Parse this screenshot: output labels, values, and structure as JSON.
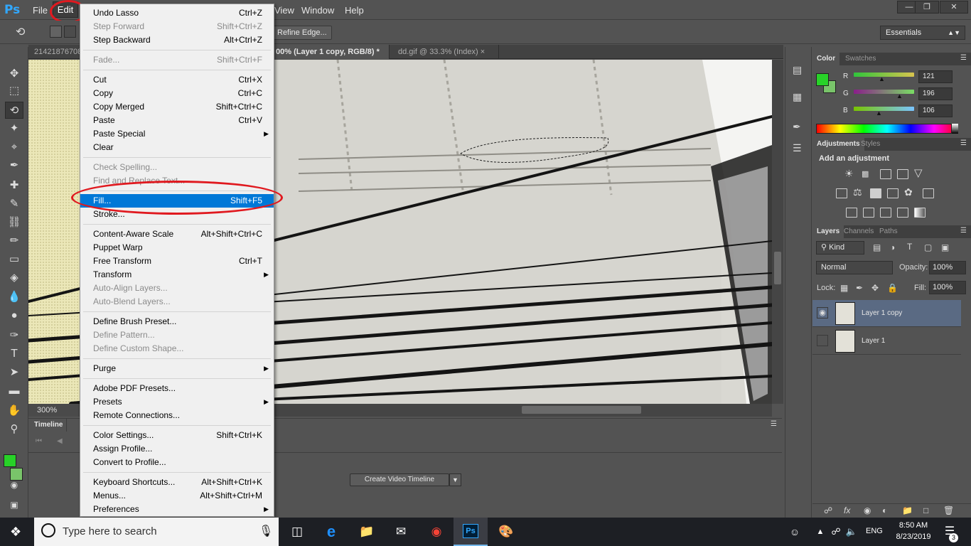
{
  "app": {
    "logo": "Ps",
    "menus": [
      "File",
      "Edit",
      "View",
      "Window",
      "Help"
    ],
    "workspace": "Essentials",
    "window_buttons": [
      "minimize-icon",
      "restore-icon",
      "close-icon"
    ]
  },
  "options_bar": {
    "refine_edge": "Refine Edge..."
  },
  "doc_tabs": [
    {
      "label": "21421876708"
    },
    {
      "label": "00% (Layer 1 copy, RGB/8) *",
      "close": "×"
    },
    {
      "label": "dd.gif @ 33.3% (Index)",
      "close": "×"
    }
  ],
  "status": {
    "zoom": "300%"
  },
  "timeline": {
    "title": "Timeline",
    "button": "Create Video Timeline"
  },
  "edit_menu": {
    "items": [
      {
        "label": "Undo Lasso",
        "shortcut": "Ctrl+Z"
      },
      {
        "label": "Step Forward",
        "shortcut": "Shift+Ctrl+Z",
        "disabled": true
      },
      {
        "label": "Step Backward",
        "shortcut": "Alt+Ctrl+Z"
      },
      {
        "sep": true
      },
      {
        "label": "Fade...",
        "shortcut": "Shift+Ctrl+F",
        "disabled": true
      },
      {
        "sep": true
      },
      {
        "label": "Cut",
        "shortcut": "Ctrl+X"
      },
      {
        "label": "Copy",
        "shortcut": "Ctrl+C"
      },
      {
        "label": "Copy Merged",
        "shortcut": "Shift+Ctrl+C"
      },
      {
        "label": "Paste",
        "shortcut": "Ctrl+V"
      },
      {
        "label": "Paste Special",
        "submenu": true
      },
      {
        "label": "Clear"
      },
      {
        "sep": true
      },
      {
        "label": "Check Spelling...",
        "disabled": true
      },
      {
        "label": "Find and Replace Text...",
        "disabled": true
      },
      {
        "sep": true
      },
      {
        "label": "Fill...",
        "shortcut": "Shift+F5",
        "highlighted": true
      },
      {
        "label": "Stroke..."
      },
      {
        "sep": true
      },
      {
        "label": "Content-Aware Scale",
        "shortcut": "Alt+Shift+Ctrl+C"
      },
      {
        "label": "Puppet Warp"
      },
      {
        "label": "Free Transform",
        "shortcut": "Ctrl+T"
      },
      {
        "label": "Transform",
        "submenu": true
      },
      {
        "label": "Auto-Align Layers...",
        "disabled": true
      },
      {
        "label": "Auto-Blend Layers...",
        "disabled": true
      },
      {
        "sep": true
      },
      {
        "label": "Define Brush Preset..."
      },
      {
        "label": "Define Pattern...",
        "disabled": true
      },
      {
        "label": "Define Custom Shape...",
        "disabled": true
      },
      {
        "sep": true
      },
      {
        "label": "Purge",
        "submenu": true
      },
      {
        "sep": true
      },
      {
        "label": "Adobe PDF Presets..."
      },
      {
        "label": "Presets",
        "submenu": true
      },
      {
        "label": "Remote Connections..."
      },
      {
        "sep": true
      },
      {
        "label": "Color Settings...",
        "shortcut": "Shift+Ctrl+K"
      },
      {
        "label": "Assign Profile..."
      },
      {
        "label": "Convert to Profile..."
      },
      {
        "sep": true
      },
      {
        "label": "Keyboard Shortcuts...",
        "shortcut": "Alt+Shift+Ctrl+K"
      },
      {
        "label": "Menus...",
        "shortcut": "Alt+Shift+Ctrl+M"
      },
      {
        "label": "Preferences",
        "submenu": true
      }
    ]
  },
  "color_panel": {
    "tabs": [
      "Color",
      "Swatches"
    ],
    "foreground": "#28d228",
    "background": "#79c46a",
    "channels": [
      {
        "label": "R",
        "value": "121",
        "fraction": 0.47
      },
      {
        "label": "G",
        "value": "196",
        "fraction": 0.77
      },
      {
        "label": "B",
        "value": "106",
        "fraction": 0.42
      }
    ]
  },
  "adjustments_panel": {
    "tabs": [
      "Adjustments",
      "Styles"
    ],
    "heading": "Add an adjustment"
  },
  "layers_panel": {
    "tabs": [
      "Layers",
      "Channels",
      "Paths"
    ],
    "kind": "Kind",
    "blend_mode": "Normal",
    "opacity_label": "Opacity:",
    "opacity": "100%",
    "lock_label": "Lock:",
    "fill_label": "Fill:",
    "fill": "100%",
    "layers": [
      {
        "name": "Layer 1 copy",
        "visible": true,
        "selected": true
      },
      {
        "name": "Layer 1",
        "visible": false,
        "selected": false
      }
    ]
  },
  "taskbar": {
    "search_placeholder": "Type here to search",
    "language": "ENG",
    "time": "8:50 AM",
    "date": "8/23/2019",
    "notifications": "3"
  }
}
